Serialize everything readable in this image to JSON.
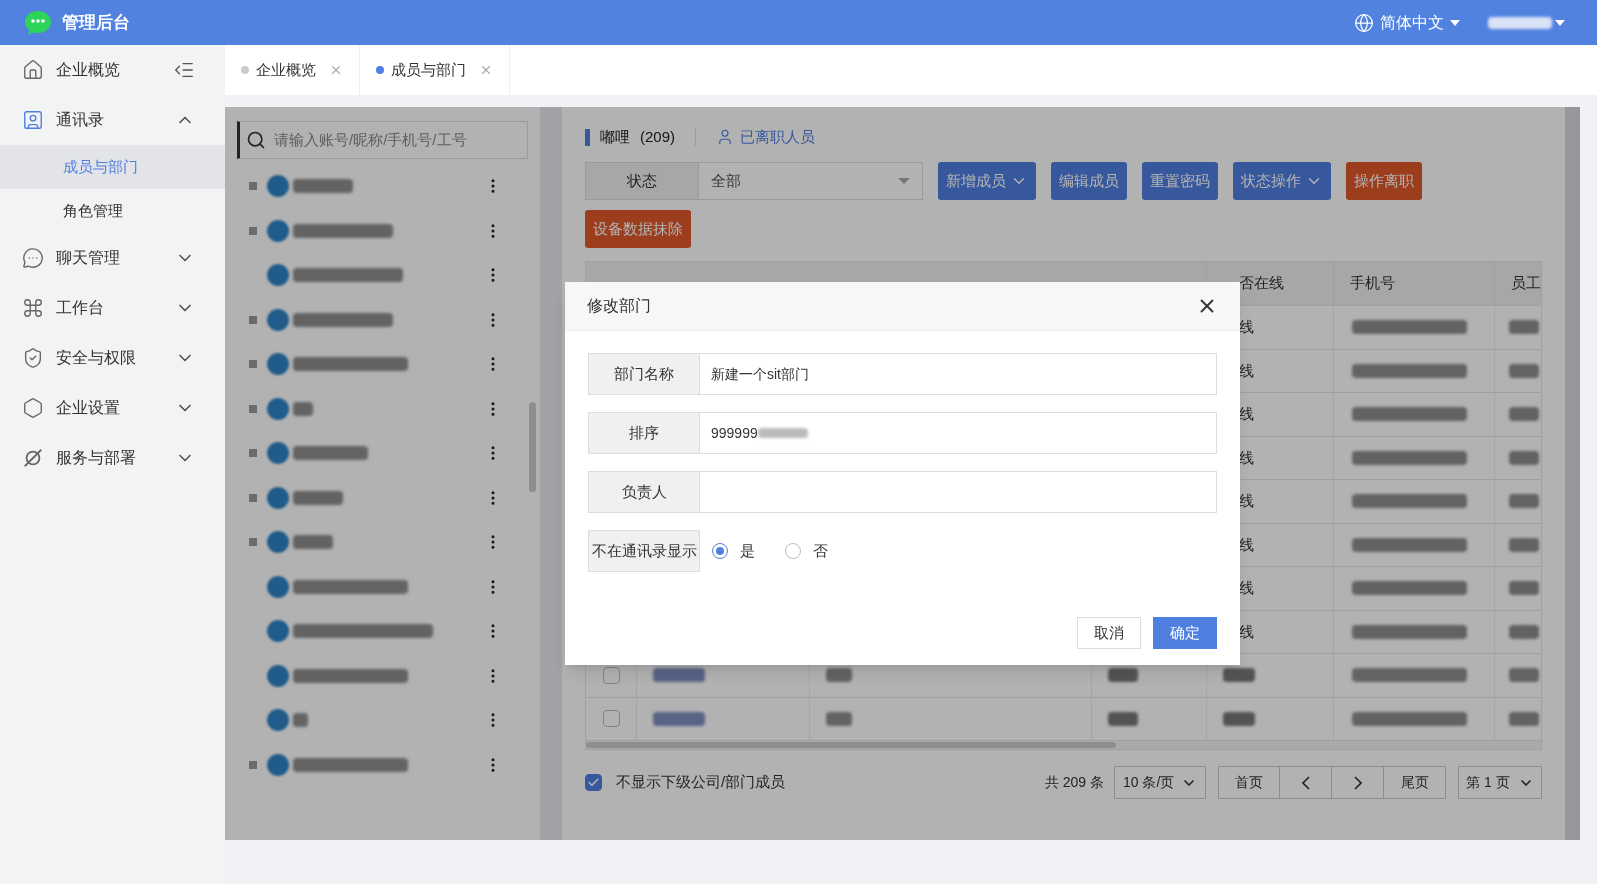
{
  "app": {
    "title": "管理后台"
  },
  "header": {
    "language": "简体中文",
    "user_redacted": true
  },
  "sidebar": {
    "items": [
      {
        "label": "企业概览",
        "kind": "link"
      },
      {
        "label": "通讯录",
        "kind": "group",
        "expanded": true,
        "children": [
          {
            "label": "成员与部门",
            "selected": true
          },
          {
            "label": "角色管理",
            "selected": false
          }
        ]
      },
      {
        "label": "聊天管理",
        "kind": "group",
        "expanded": false
      },
      {
        "label": "工作台",
        "kind": "group",
        "expanded": false
      },
      {
        "label": "安全与权限",
        "kind": "group",
        "expanded": false
      },
      {
        "label": "企业设置",
        "kind": "group",
        "expanded": false
      },
      {
        "label": "服务与部署",
        "kind": "group",
        "expanded": false
      }
    ]
  },
  "tabs": [
    {
      "label": "企业概览",
      "selected": false
    },
    {
      "label": "成员与部门",
      "selected": true
    }
  ],
  "tree": {
    "search_placeholder": "请输入账号/昵称/手机号/工号",
    "nodes": [
      {
        "has_toggle": true
      },
      {
        "has_toggle": true,
        "children": [
          {
            "has_toggle": false
          }
        ]
      },
      {
        "has_toggle": true
      },
      {
        "has_toggle": true
      },
      {
        "has_toggle": true
      },
      {
        "has_toggle": true
      },
      {
        "has_toggle": true
      },
      {
        "has_toggle": true,
        "children": [
          {
            "has_toggle": false
          },
          {
            "has_toggle": false
          },
          {
            "has_toggle": false
          },
          {
            "has_toggle": false
          }
        ]
      },
      {
        "has_toggle": true
      }
    ]
  },
  "panel": {
    "department": "嘟哩",
    "count": "(209)",
    "resigned_link": "已离职人员",
    "filter": {
      "label": "状态",
      "value": "全部"
    },
    "actions": [
      {
        "label": "新增成员",
        "kind": "primary",
        "dropdown": true
      },
      {
        "label": "编辑成员",
        "kind": "primary",
        "dropdown": false
      },
      {
        "label": "重置密码",
        "kind": "primary",
        "dropdown": false
      },
      {
        "label": "状态操作",
        "kind": "primary",
        "dropdown": true
      },
      {
        "label": "操作离职",
        "kind": "danger",
        "dropdown": false
      },
      {
        "label": "设备数据抹除",
        "kind": "danger",
        "dropdown": false
      }
    ],
    "table": {
      "headers": [
        {
          "label": "否在线"
        },
        {
          "label": "手机号"
        },
        {
          "label": "员工"
        }
      ],
      "rows": [
        {
          "online": "线"
        },
        {
          "online": "线"
        },
        {
          "online": "线"
        },
        {
          "online": "线"
        },
        {
          "online": "线"
        },
        {
          "online": "线"
        },
        {
          "online": "线"
        },
        {
          "online": "线"
        },
        {
          "checked": false
        },
        {
          "checked": false
        }
      ]
    },
    "footer": {
      "hide_sub_members": {
        "label": "不显示下级公司/部门成员",
        "checked": true
      },
      "total": "共 209 条",
      "page_size": "10 条/页",
      "first": "首页",
      "last": "尾页",
      "page": "第 1 页"
    }
  },
  "modal": {
    "title": "修改部门",
    "fields": [
      {
        "kind": "text",
        "label": "部门名称",
        "value": "新建一个sit部门"
      },
      {
        "kind": "text",
        "label": "排序",
        "value": "999999",
        "redacted": true
      },
      {
        "kind": "text",
        "label": "负责人"
      },
      {
        "kind": "radio",
        "label": "不在通讯录显示",
        "options": [
          {
            "label": "是",
            "selected": true
          },
          {
            "label": "否",
            "selected": false
          }
        ]
      }
    ],
    "cancel": "取消",
    "ok": "确定"
  }
}
